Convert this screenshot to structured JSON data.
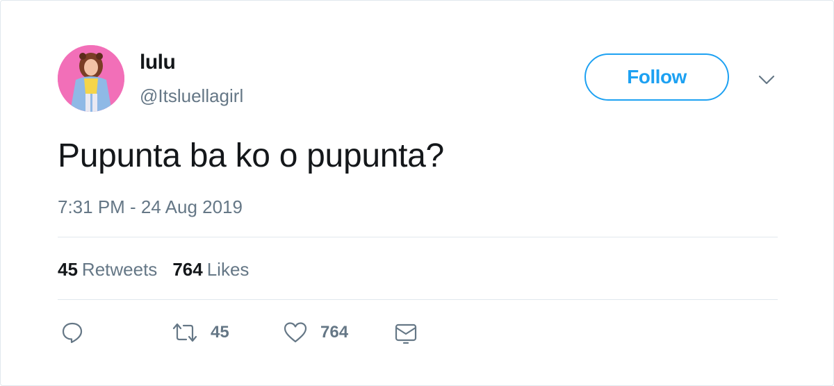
{
  "user": {
    "display_name": "lulu",
    "handle": "@Itsluellagirl",
    "avatar_colors": {
      "background": "#f26fb8",
      "hair": "#7a3e25",
      "skin": "#f2c2a5",
      "jacket": "#8fb9e6",
      "top": "#f5d54a"
    }
  },
  "follow_button": {
    "label": "Follow",
    "color": "#1da1f2"
  },
  "menu": {
    "icon": "chevron-down-icon"
  },
  "tweet": {
    "text": "Pupunta ba ko o pupunta?",
    "timestamp": "7:31 PM - 24 Aug 2019"
  },
  "stats": {
    "retweets": {
      "count": "45",
      "label": "Retweets"
    },
    "likes": {
      "count": "764",
      "label": "Likes"
    }
  },
  "actions": {
    "reply": {
      "icon": "reply-icon"
    },
    "retweet": {
      "icon": "retweet-icon",
      "count": "45"
    },
    "like": {
      "icon": "heart-icon",
      "count": "764"
    },
    "dm": {
      "icon": "envelope-icon"
    }
  },
  "colors": {
    "text_primary": "#14171a",
    "text_secondary": "#657786",
    "border": "#e1e8ed",
    "accent": "#1da1f2"
  }
}
